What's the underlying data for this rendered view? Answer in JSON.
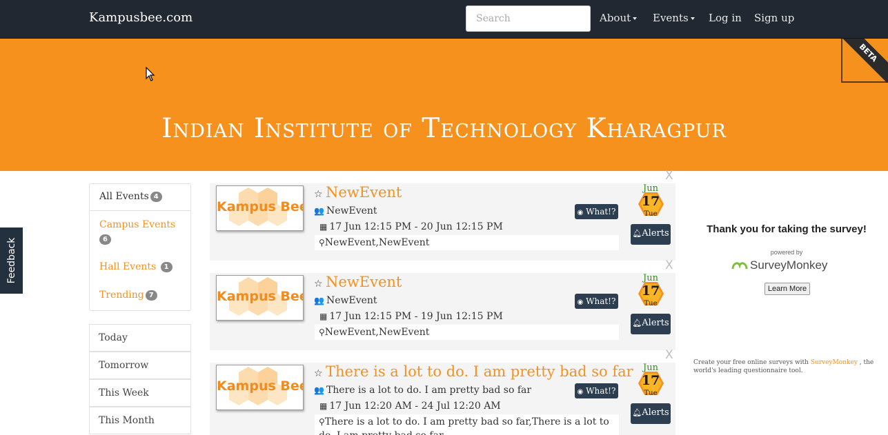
{
  "navbar": {
    "brand": "Kampusbee.com",
    "search_placeholder": "Search",
    "about": "About",
    "events": "Events",
    "login": "Log in",
    "signup": "Sign up"
  },
  "hero": {
    "title": "Indian Institute of Technology Kharagpur",
    "beta": "BETA"
  },
  "feedback": "Feedback",
  "sidebar": {
    "categories": [
      {
        "label": "All Events",
        "count": "4"
      },
      {
        "label": "Campus Events",
        "count": "6"
      },
      {
        "label": "Hall Events",
        "count": "1"
      },
      {
        "label": "Trending",
        "count": "7"
      }
    ],
    "times": [
      "Today",
      "Tomorrow",
      "This Week",
      "This Month"
    ]
  },
  "events": [
    {
      "title": "NewEvent",
      "organizer": "NewEvent",
      "datetime": "17 Jun 12:15 PM - 20 Jun 12:15 PM",
      "location": "NewEvent,NewEvent",
      "month": "Jun",
      "day": "17",
      "weekday": "Tue",
      "thumb_text": "Kampus Bee",
      "what": "What!?",
      "alerts": "Alerts",
      "close": "X"
    },
    {
      "title": "NewEvent",
      "organizer": "NewEvent",
      "datetime": "17 Jun 12:15 PM - 19 Jun 12:15 PM",
      "location": "NewEvent,NewEvent",
      "month": "Jun",
      "day": "17",
      "weekday": "Tue",
      "thumb_text": "Kampus Bee",
      "what": "What!?",
      "alerts": "Alerts",
      "close": "X"
    },
    {
      "title": "There is a lot to do. I am pretty bad so far",
      "organizer": "There is a lot to do. I am pretty bad so far",
      "datetime": "17 Jun 12:20 AM - 24 Jul 12:20 AM",
      "location": "There is a lot to do. I am pretty bad so far,There is a lot to do. I am pretty bad so far",
      "month": "Jun",
      "day": "17",
      "weekday": "Tue",
      "thumb_text": "Kampus Bee",
      "what": "What!?",
      "alerts": "Alerts",
      "close": "X"
    }
  ],
  "survey": {
    "title": "Thank you for taking the survey!",
    "powered_by": "powered by",
    "brand": "SurveyMonkey",
    "learn_more": "Learn More",
    "create_prefix": "Create your free online surveys with",
    "create_link": "SurveyMonkey",
    "create_suffix": ", the world's leading questionnaire tool."
  },
  "colors": {
    "navbar": "#222831",
    "accent": "#f6911e",
    "button": "#2c3e50"
  }
}
